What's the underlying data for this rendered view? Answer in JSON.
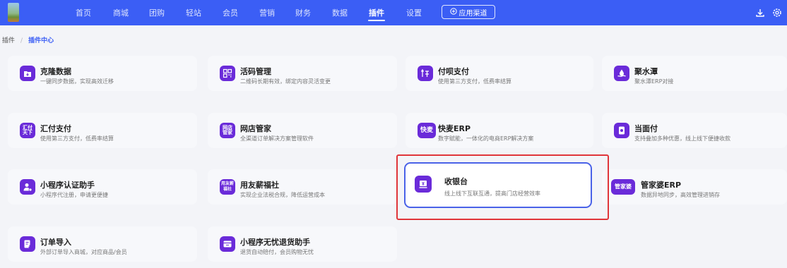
{
  "topbar": {
    "nav": [
      "首页",
      "商城",
      "团购",
      "轻站",
      "会员",
      "营销",
      "财务",
      "数据",
      "插件",
      "设置"
    ],
    "active_nav": "插件",
    "channel_label": "应用渠道"
  },
  "breadcrumb": {
    "root": "插件",
    "separator": "/",
    "current": "插件中心"
  },
  "plugins": [
    {
      "title": "克隆数据",
      "desc": "一键同步数据，实现高效迁移",
      "icon": "download-icon"
    },
    {
      "title": "活码管理",
      "desc": "二维码长期有效，绑定内容灵活变更",
      "icon": "qrcode-icon"
    },
    {
      "title": "付呗支付",
      "desc": "使用第三方支付，低费率结算",
      "icon": "fubei-icon"
    },
    {
      "title": "聚水潭",
      "desc": "聚水潭ERP对接",
      "icon": "water-drop-icon"
    },
    {
      "title": "汇付支付",
      "desc": "使用第三方支付，低费率结算",
      "icon": "huifu-icon",
      "icon_text": "汇付天下"
    },
    {
      "title": "网店管家",
      "desc": "全渠道订单解决方案管理软件",
      "icon": "wangdian-icon",
      "icon_text": "网店管家"
    },
    {
      "title": "快麦ERP",
      "desc": "数字赋能，一体化的电商ERP解决方案",
      "icon": "kuaimai-icon",
      "icon_text": "快麦"
    },
    {
      "title": "当面付",
      "desc": "支持叠加多种优惠，线上线下便捷收款",
      "icon": "pay-card-icon"
    },
    {
      "title": "小程序认证助手",
      "desc": "小程序代注册，申请更便捷",
      "icon": "user-cert-icon"
    },
    {
      "title": "用友薪福社",
      "desc": "实现企业法税合规，降低运营成本",
      "icon": "yonyou-icon",
      "icon_text": "用友薪福社"
    },
    {
      "title": "收银台",
      "desc": "线上线下互联互通，提高门店经营效率",
      "icon": "cashier-icon"
    },
    {
      "title": "管家婆ERP",
      "desc": "数据异地同步，高效管理进销存",
      "icon": "guanjiapo-icon",
      "icon_text": "管家婆"
    },
    {
      "title": "订单导入",
      "desc": "外部订单导入商城，对应商品/会员",
      "icon": "order-import-icon"
    },
    {
      "title": "小程序无忧退货助手",
      "desc": "退货自动赔付，会员购物无忧",
      "icon": "return-icon"
    }
  ],
  "selected_plugin": "收银台",
  "colors": {
    "topbar": "#3b5ef5",
    "icon_bg": "#6a2bd9",
    "selection_border": "#4a62e8",
    "highlight_border": "#e0353a"
  }
}
